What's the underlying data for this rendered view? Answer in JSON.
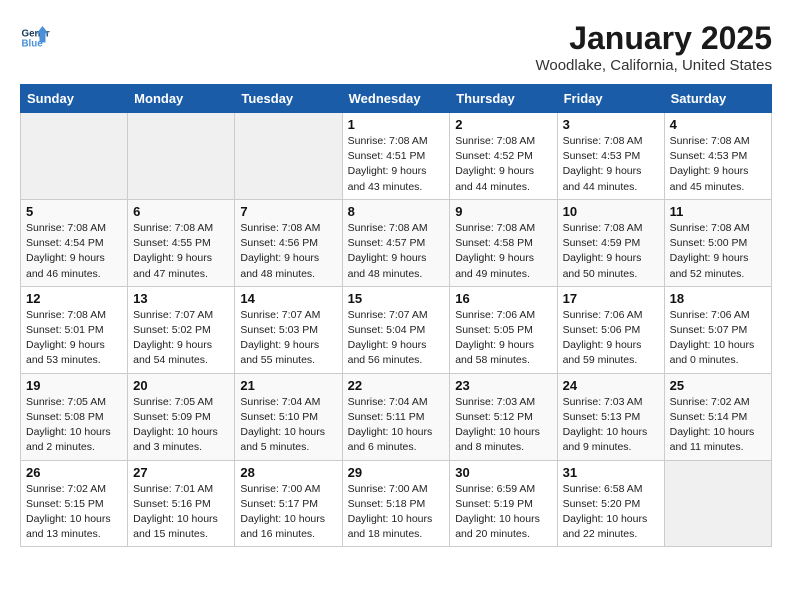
{
  "logo": {
    "line1": "General",
    "line2": "Blue"
  },
  "title": "January 2025",
  "location": "Woodlake, California, United States",
  "weekdays": [
    "Sunday",
    "Monday",
    "Tuesday",
    "Wednesday",
    "Thursday",
    "Friday",
    "Saturday"
  ],
  "weeks": [
    [
      {
        "day": "",
        "info": ""
      },
      {
        "day": "",
        "info": ""
      },
      {
        "day": "",
        "info": ""
      },
      {
        "day": "1",
        "info": "Sunrise: 7:08 AM\nSunset: 4:51 PM\nDaylight: 9 hours\nand 43 minutes."
      },
      {
        "day": "2",
        "info": "Sunrise: 7:08 AM\nSunset: 4:52 PM\nDaylight: 9 hours\nand 44 minutes."
      },
      {
        "day": "3",
        "info": "Sunrise: 7:08 AM\nSunset: 4:53 PM\nDaylight: 9 hours\nand 44 minutes."
      },
      {
        "day": "4",
        "info": "Sunrise: 7:08 AM\nSunset: 4:53 PM\nDaylight: 9 hours\nand 45 minutes."
      }
    ],
    [
      {
        "day": "5",
        "info": "Sunrise: 7:08 AM\nSunset: 4:54 PM\nDaylight: 9 hours\nand 46 minutes."
      },
      {
        "day": "6",
        "info": "Sunrise: 7:08 AM\nSunset: 4:55 PM\nDaylight: 9 hours\nand 47 minutes."
      },
      {
        "day": "7",
        "info": "Sunrise: 7:08 AM\nSunset: 4:56 PM\nDaylight: 9 hours\nand 48 minutes."
      },
      {
        "day": "8",
        "info": "Sunrise: 7:08 AM\nSunset: 4:57 PM\nDaylight: 9 hours\nand 48 minutes."
      },
      {
        "day": "9",
        "info": "Sunrise: 7:08 AM\nSunset: 4:58 PM\nDaylight: 9 hours\nand 49 minutes."
      },
      {
        "day": "10",
        "info": "Sunrise: 7:08 AM\nSunset: 4:59 PM\nDaylight: 9 hours\nand 50 minutes."
      },
      {
        "day": "11",
        "info": "Sunrise: 7:08 AM\nSunset: 5:00 PM\nDaylight: 9 hours\nand 52 minutes."
      }
    ],
    [
      {
        "day": "12",
        "info": "Sunrise: 7:08 AM\nSunset: 5:01 PM\nDaylight: 9 hours\nand 53 minutes."
      },
      {
        "day": "13",
        "info": "Sunrise: 7:07 AM\nSunset: 5:02 PM\nDaylight: 9 hours\nand 54 minutes."
      },
      {
        "day": "14",
        "info": "Sunrise: 7:07 AM\nSunset: 5:03 PM\nDaylight: 9 hours\nand 55 minutes."
      },
      {
        "day": "15",
        "info": "Sunrise: 7:07 AM\nSunset: 5:04 PM\nDaylight: 9 hours\nand 56 minutes."
      },
      {
        "day": "16",
        "info": "Sunrise: 7:06 AM\nSunset: 5:05 PM\nDaylight: 9 hours\nand 58 minutes."
      },
      {
        "day": "17",
        "info": "Sunrise: 7:06 AM\nSunset: 5:06 PM\nDaylight: 9 hours\nand 59 minutes."
      },
      {
        "day": "18",
        "info": "Sunrise: 7:06 AM\nSunset: 5:07 PM\nDaylight: 10 hours\nand 0 minutes."
      }
    ],
    [
      {
        "day": "19",
        "info": "Sunrise: 7:05 AM\nSunset: 5:08 PM\nDaylight: 10 hours\nand 2 minutes."
      },
      {
        "day": "20",
        "info": "Sunrise: 7:05 AM\nSunset: 5:09 PM\nDaylight: 10 hours\nand 3 minutes."
      },
      {
        "day": "21",
        "info": "Sunrise: 7:04 AM\nSunset: 5:10 PM\nDaylight: 10 hours\nand 5 minutes."
      },
      {
        "day": "22",
        "info": "Sunrise: 7:04 AM\nSunset: 5:11 PM\nDaylight: 10 hours\nand 6 minutes."
      },
      {
        "day": "23",
        "info": "Sunrise: 7:03 AM\nSunset: 5:12 PM\nDaylight: 10 hours\nand 8 minutes."
      },
      {
        "day": "24",
        "info": "Sunrise: 7:03 AM\nSunset: 5:13 PM\nDaylight: 10 hours\nand 9 minutes."
      },
      {
        "day": "25",
        "info": "Sunrise: 7:02 AM\nSunset: 5:14 PM\nDaylight: 10 hours\nand 11 minutes."
      }
    ],
    [
      {
        "day": "26",
        "info": "Sunrise: 7:02 AM\nSunset: 5:15 PM\nDaylight: 10 hours\nand 13 minutes."
      },
      {
        "day": "27",
        "info": "Sunrise: 7:01 AM\nSunset: 5:16 PM\nDaylight: 10 hours\nand 15 minutes."
      },
      {
        "day": "28",
        "info": "Sunrise: 7:00 AM\nSunset: 5:17 PM\nDaylight: 10 hours\nand 16 minutes."
      },
      {
        "day": "29",
        "info": "Sunrise: 7:00 AM\nSunset: 5:18 PM\nDaylight: 10 hours\nand 18 minutes."
      },
      {
        "day": "30",
        "info": "Sunrise: 6:59 AM\nSunset: 5:19 PM\nDaylight: 10 hours\nand 20 minutes."
      },
      {
        "day": "31",
        "info": "Sunrise: 6:58 AM\nSunset: 5:20 PM\nDaylight: 10 hours\nand 22 minutes."
      },
      {
        "day": "",
        "info": ""
      }
    ]
  ]
}
